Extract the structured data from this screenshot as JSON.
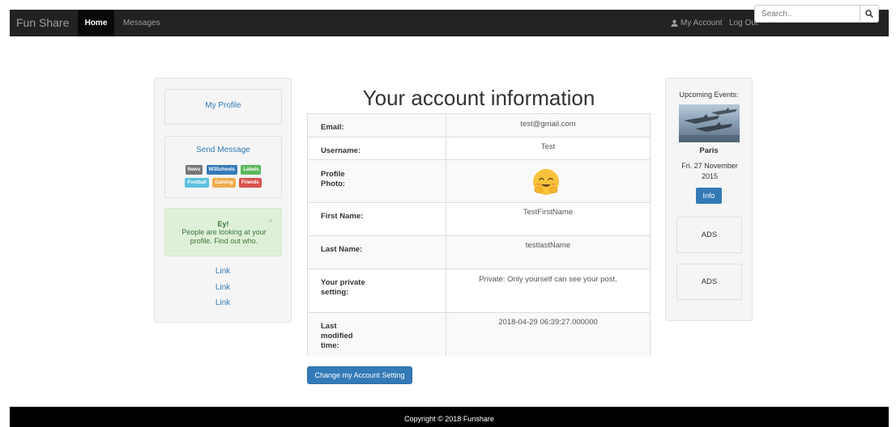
{
  "navbar": {
    "brand": "Fun Share",
    "home": "Home",
    "messages": "Messages",
    "my_account": "My Account",
    "logout": "Log Out",
    "search_placeholder": "Search.."
  },
  "left_sidebar": {
    "my_profile": "My Profile",
    "send_message": "Send Message",
    "labels": [
      {
        "text": "News",
        "color": "#777777"
      },
      {
        "text": "W3Schools",
        "color": "#337ab7"
      },
      {
        "text": "Labels",
        "color": "#5cb85c"
      },
      {
        "text": "Football",
        "color": "#5bc0de"
      },
      {
        "text": "Gaming",
        "color": "#f0ad4e"
      },
      {
        "text": "Friends",
        "color": "#d9534f"
      }
    ],
    "alert": {
      "title": "Ey!",
      "text": "People are looking at your profile. Find out who.",
      "close": "×"
    },
    "links": [
      "Link",
      "Link",
      "Link"
    ]
  },
  "main": {
    "title": "Your account information",
    "rows": [
      {
        "label": "Email:",
        "value": "test@gmail.com"
      },
      {
        "label": "Username:",
        "value": "Test"
      },
      {
        "label": "Profile Photo:",
        "value": ""
      },
      {
        "label": "First Name:",
        "value": "TestFirstName"
      },
      {
        "label": "Last Name:",
        "value": "testlastName"
      },
      {
        "label": "Your private setting:",
        "value": "Private: Only yourself can see your post."
      },
      {
        "label": "Last modified time:",
        "value": "2018-04-29 06:39:27.000000"
      }
    ],
    "change_button": "Change my Account Setting"
  },
  "right_sidebar": {
    "events_title": "Upcoming Events:",
    "city": "Paris",
    "date": "Fri. 27 November 2015",
    "info_button": "Info",
    "ads": [
      "ADS",
      "ADS"
    ]
  },
  "footer": {
    "copyright": "Copyright © 2018 Funshare"
  },
  "colors": {
    "navbar": "#222222",
    "primary": "#337ab7",
    "alert_bg": "#dff0d8",
    "footer": "#000000"
  }
}
